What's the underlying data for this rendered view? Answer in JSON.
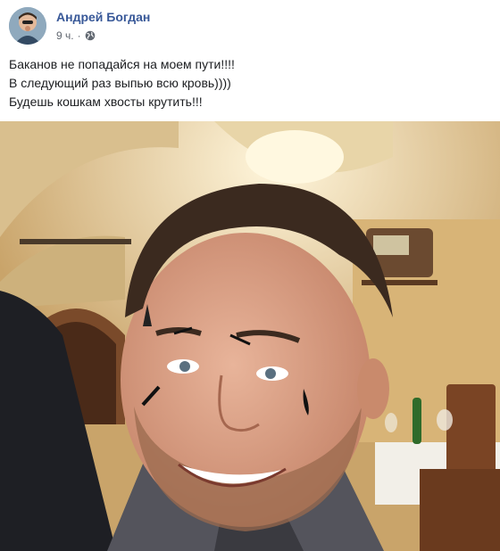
{
  "post": {
    "author": "Андрей Богдан",
    "time": "9 ч.",
    "separator": "·",
    "privacy_icon": "globe-icon",
    "text_lines": [
      "Баканов не попадайся на моем пути!!!!",
      "В следующий раз выпью всю кровь))))",
      "Будешь кошкам хвосты крутить!!!"
    ]
  },
  "colors": {
    "author_link": "#385898",
    "meta_text": "#616770",
    "body_text": "#1c1e21"
  }
}
